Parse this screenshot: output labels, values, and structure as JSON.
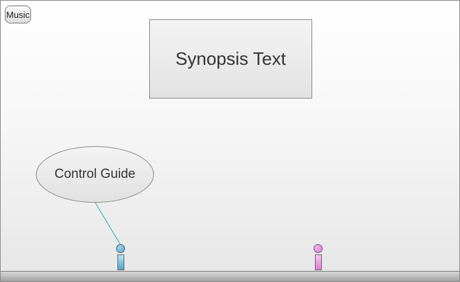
{
  "toolbar": {
    "music_label": "Music"
  },
  "main": {
    "synopsis_text": "Synopsis Text",
    "control_guide_text": "Control Guide"
  },
  "players": [
    {
      "name": "blue-player",
      "color": "#4ea3cf"
    },
    {
      "name": "pink-player",
      "color": "#df6fd7"
    }
  ],
  "colors": {
    "pointer_line": "#2aa6c9"
  }
}
